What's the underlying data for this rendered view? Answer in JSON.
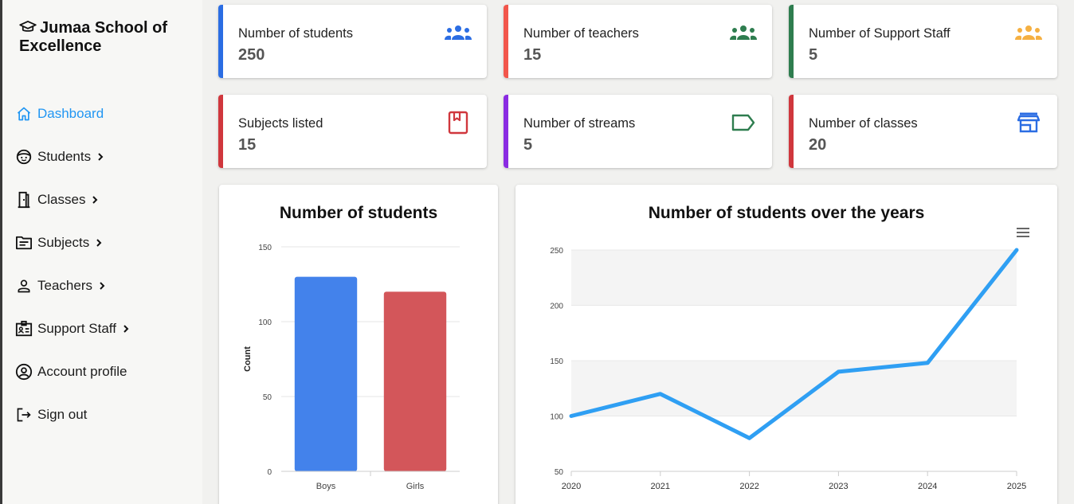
{
  "sidebar": {
    "brand": "Jumaa School of Excellence",
    "items": [
      {
        "label": "Dashboard",
        "icon": "home-icon",
        "active": true,
        "chevron": false
      },
      {
        "label": "Students",
        "icon": "smiley-icon",
        "active": false,
        "chevron": true
      },
      {
        "label": "Classes",
        "icon": "door-icon",
        "active": false,
        "chevron": true
      },
      {
        "label": "Subjects",
        "icon": "folder-icon",
        "active": false,
        "chevron": true
      },
      {
        "label": "Teachers",
        "icon": "person-icon",
        "active": false,
        "chevron": true
      },
      {
        "label": "Support Staff",
        "icon": "id-badge-icon",
        "active": false,
        "chevron": true
      },
      {
        "label": "Account profile",
        "icon": "account-circle-icon",
        "active": false,
        "chevron": false
      },
      {
        "label": "Sign out",
        "icon": "sign-out-icon",
        "active": false,
        "chevron": false
      }
    ]
  },
  "cards": [
    {
      "label": "Number of students",
      "value": "250",
      "accent": "#2b6de3",
      "icon": "group-icon",
      "icon_color": "#2b6de3"
    },
    {
      "label": "Number of teachers",
      "value": "15",
      "accent": "#f2564b",
      "icon": "group-icon",
      "icon_color": "#2e7d4f"
    },
    {
      "label": "Number of Support Staff",
      "value": "5",
      "accent": "#2e7d4f",
      "icon": "group-icon",
      "icon_color": "#f5b042"
    },
    {
      "label": "Subjects listed",
      "value": "15",
      "accent": "#d0373d",
      "icon": "bookmark-book-icon",
      "icon_color": "#d0373d"
    },
    {
      "label": "Number of streams",
      "value": "5",
      "accent": "#8a2be2",
      "icon": "label-tag-icon",
      "icon_color": "#2e7d4f"
    },
    {
      "label": "Number of classes",
      "value": "20",
      "accent": "#d0373d",
      "icon": "storefront-icon",
      "icon_color": "#2b6de3"
    }
  ],
  "chart_data": [
    {
      "type": "bar",
      "title": "Number of students",
      "categories": [
        "Boys",
        "Girls"
      ],
      "values": [
        130,
        120
      ],
      "colors": [
        "#4382eb",
        "#d3565a"
      ],
      "ylabel": "Count",
      "xlabel": "",
      "ylim": [
        0,
        150
      ],
      "yticks": [
        0,
        50,
        100,
        150
      ],
      "grid": true
    },
    {
      "type": "line",
      "title": "Number of students over the years",
      "x": [
        "2020",
        "2021",
        "2022",
        "2023",
        "2024",
        "2025"
      ],
      "series": [
        {
          "values": [
            100,
            120,
            80,
            140,
            148,
            250
          ]
        }
      ],
      "color": "#2f9ff3",
      "ylim": [
        50,
        250
      ],
      "yticks": [
        50,
        100,
        150,
        200,
        250
      ],
      "banded_background": true,
      "menu_icon": "hamburger-menu-icon"
    }
  ]
}
